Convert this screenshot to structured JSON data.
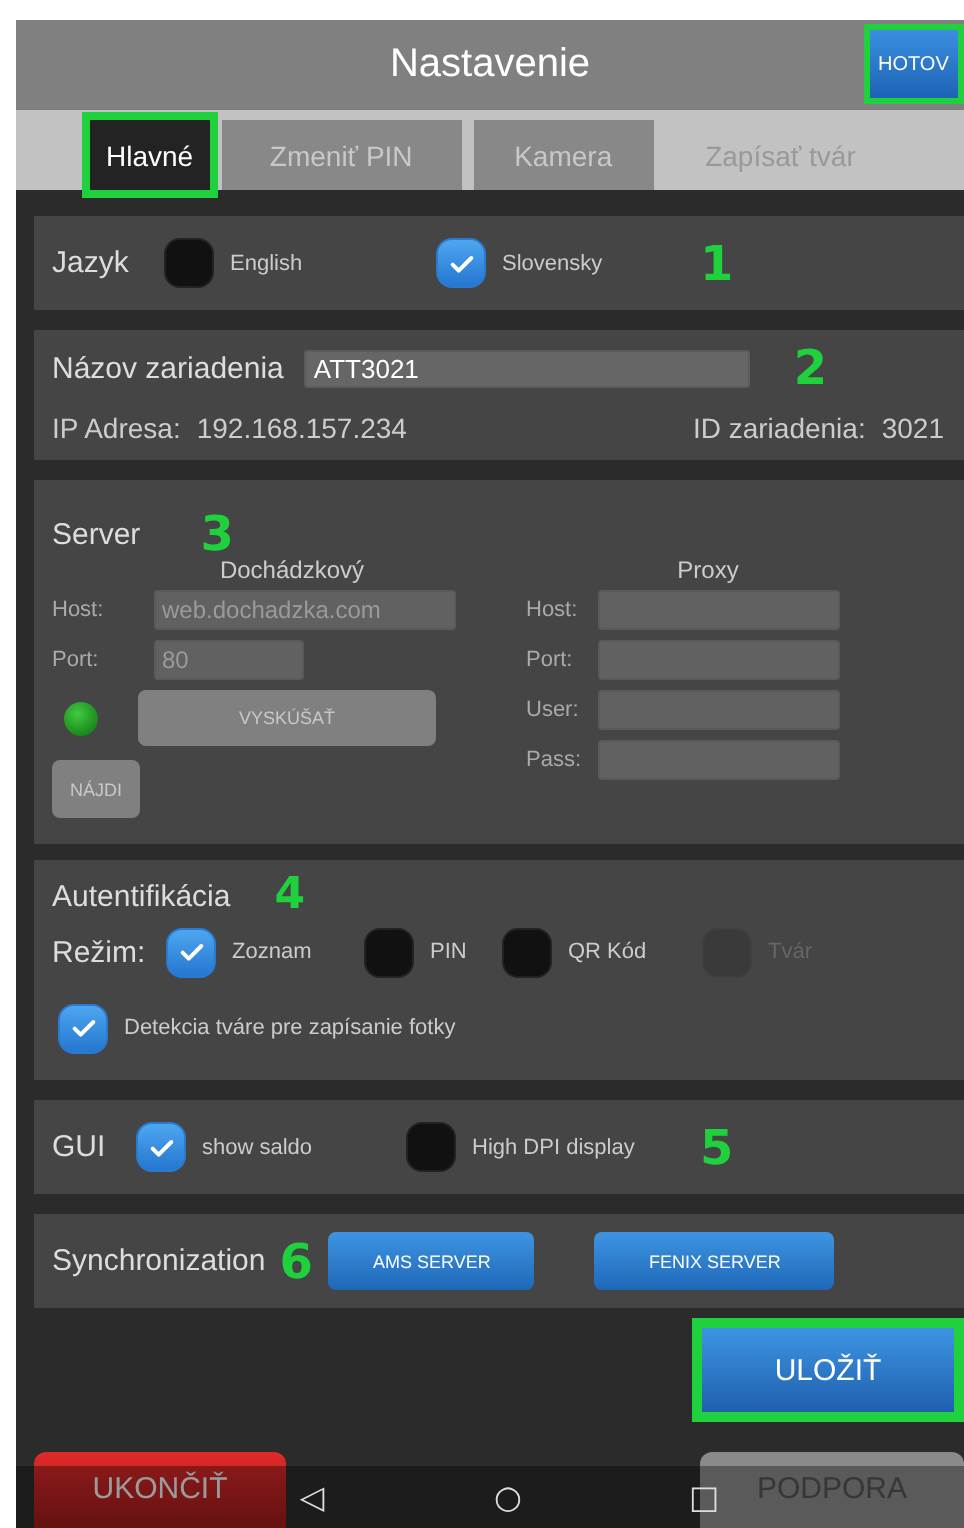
{
  "header": {
    "title": "Nastavenie",
    "done_button": {
      "label": "HOTOV",
      "highlighted": true
    }
  },
  "tabs": [
    {
      "label": "Hlavné",
      "kind": "tab",
      "selected": true,
      "highlighted": true
    },
    {
      "label": "Zmeniť PIN",
      "kind": "tab",
      "selected": false,
      "highlighted": false
    },
    {
      "label": "Kamera",
      "kind": "tab",
      "selected": false,
      "highlighted": false
    },
    {
      "label": "Zapísať tvár",
      "kind": "plain",
      "selected": false,
      "highlighted": false
    }
  ],
  "language": {
    "label": "Jazyk",
    "callout": "1",
    "options": [
      {
        "label": "English",
        "checked": false
      },
      {
        "label": "Slovensky",
        "checked": true
      }
    ]
  },
  "device": {
    "name_label": "Názov zariadenia",
    "name_value": "ATT3021",
    "callout": "2",
    "ip_label": "IP Adresa:",
    "ip_value": "192.168.157.234",
    "id_label": "ID zariadenia:",
    "id_value": "3021"
  },
  "server": {
    "title": "Server",
    "callout": "3",
    "attendance": {
      "title": "Dochádzkový",
      "fields": [
        {
          "label": "Host:",
          "placeholder": "web.dochadzka.com",
          "kind": "wide"
        },
        {
          "label": "Port:",
          "placeholder": "80",
          "kind": "narrow"
        }
      ],
      "connected": true,
      "test_button": "VYSKÚŠAŤ",
      "find_button": "NÁJDI"
    },
    "proxy": {
      "title": "Proxy",
      "fields": [
        {
          "label": "Host:"
        },
        {
          "label": "Port:"
        },
        {
          "label": "User:"
        },
        {
          "label": "Pass:"
        }
      ]
    }
  },
  "authentication": {
    "title": "Autentifikácia",
    "callout": "4",
    "mode_label": "Režim:",
    "modes": [
      {
        "label": "Zoznam",
        "checked": true,
        "disabled": false
      },
      {
        "label": "PIN",
        "checked": false,
        "disabled": false
      },
      {
        "label": "QR Kód",
        "checked": false,
        "disabled": false
      },
      {
        "label": "Tvár",
        "checked": false,
        "disabled": true
      }
    ],
    "face_detection": {
      "label": "Detekcia tváre pre zapísanie fotky",
      "checked": true
    }
  },
  "gui": {
    "label": "GUI",
    "callout": "5",
    "options": [
      {
        "label": "show saldo",
        "checked": true
      },
      {
        "label": "High DPI display",
        "checked": false
      }
    ]
  },
  "sync": {
    "label": "Synchronization",
    "callout": "6",
    "buttons": [
      "AMS SERVER",
      "FENIX SERVER"
    ]
  },
  "save_button": {
    "label": "ULOŽIŤ",
    "highlighted": true
  },
  "footer_buttons": [
    {
      "label": "UKONČIŤ",
      "kind": "danger"
    },
    {
      "label": "PODPORA",
      "kind": "neutral"
    }
  ],
  "nav_bar": {
    "back": "◁",
    "home": "○",
    "recent": "□"
  }
}
